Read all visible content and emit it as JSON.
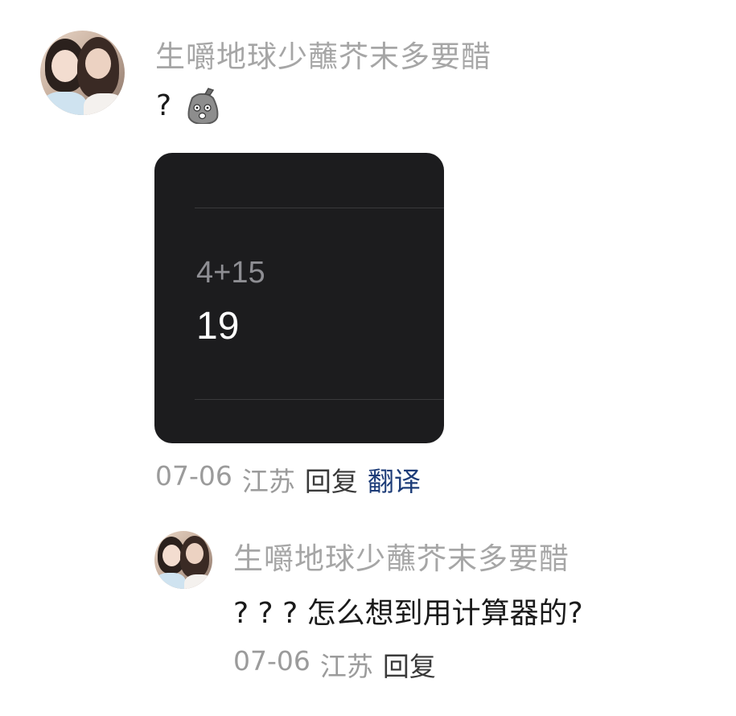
{
  "main_comment": {
    "username": "生嚼地球少蘸芥末多要醋",
    "text": "?",
    "emoji": "shocked-sack-emoji-icon",
    "image": {
      "expression": "4+15",
      "result": "19"
    },
    "meta": {
      "date": "07-06",
      "location": "江苏",
      "reply_label": "回复",
      "translate_label": "翻译"
    }
  },
  "reply_comment": {
    "username": "生嚼地球少蘸芥末多要醋",
    "text": "? ? ?  怎么想到用计算器的?",
    "meta": {
      "date": "07-06",
      "location": "江苏",
      "reply_label": "回复"
    }
  },
  "colors": {
    "username": "#a6a6a6",
    "meta": "#9b9b9b",
    "translate": "#1d3c78",
    "card_bg": "#1c1c1e"
  }
}
